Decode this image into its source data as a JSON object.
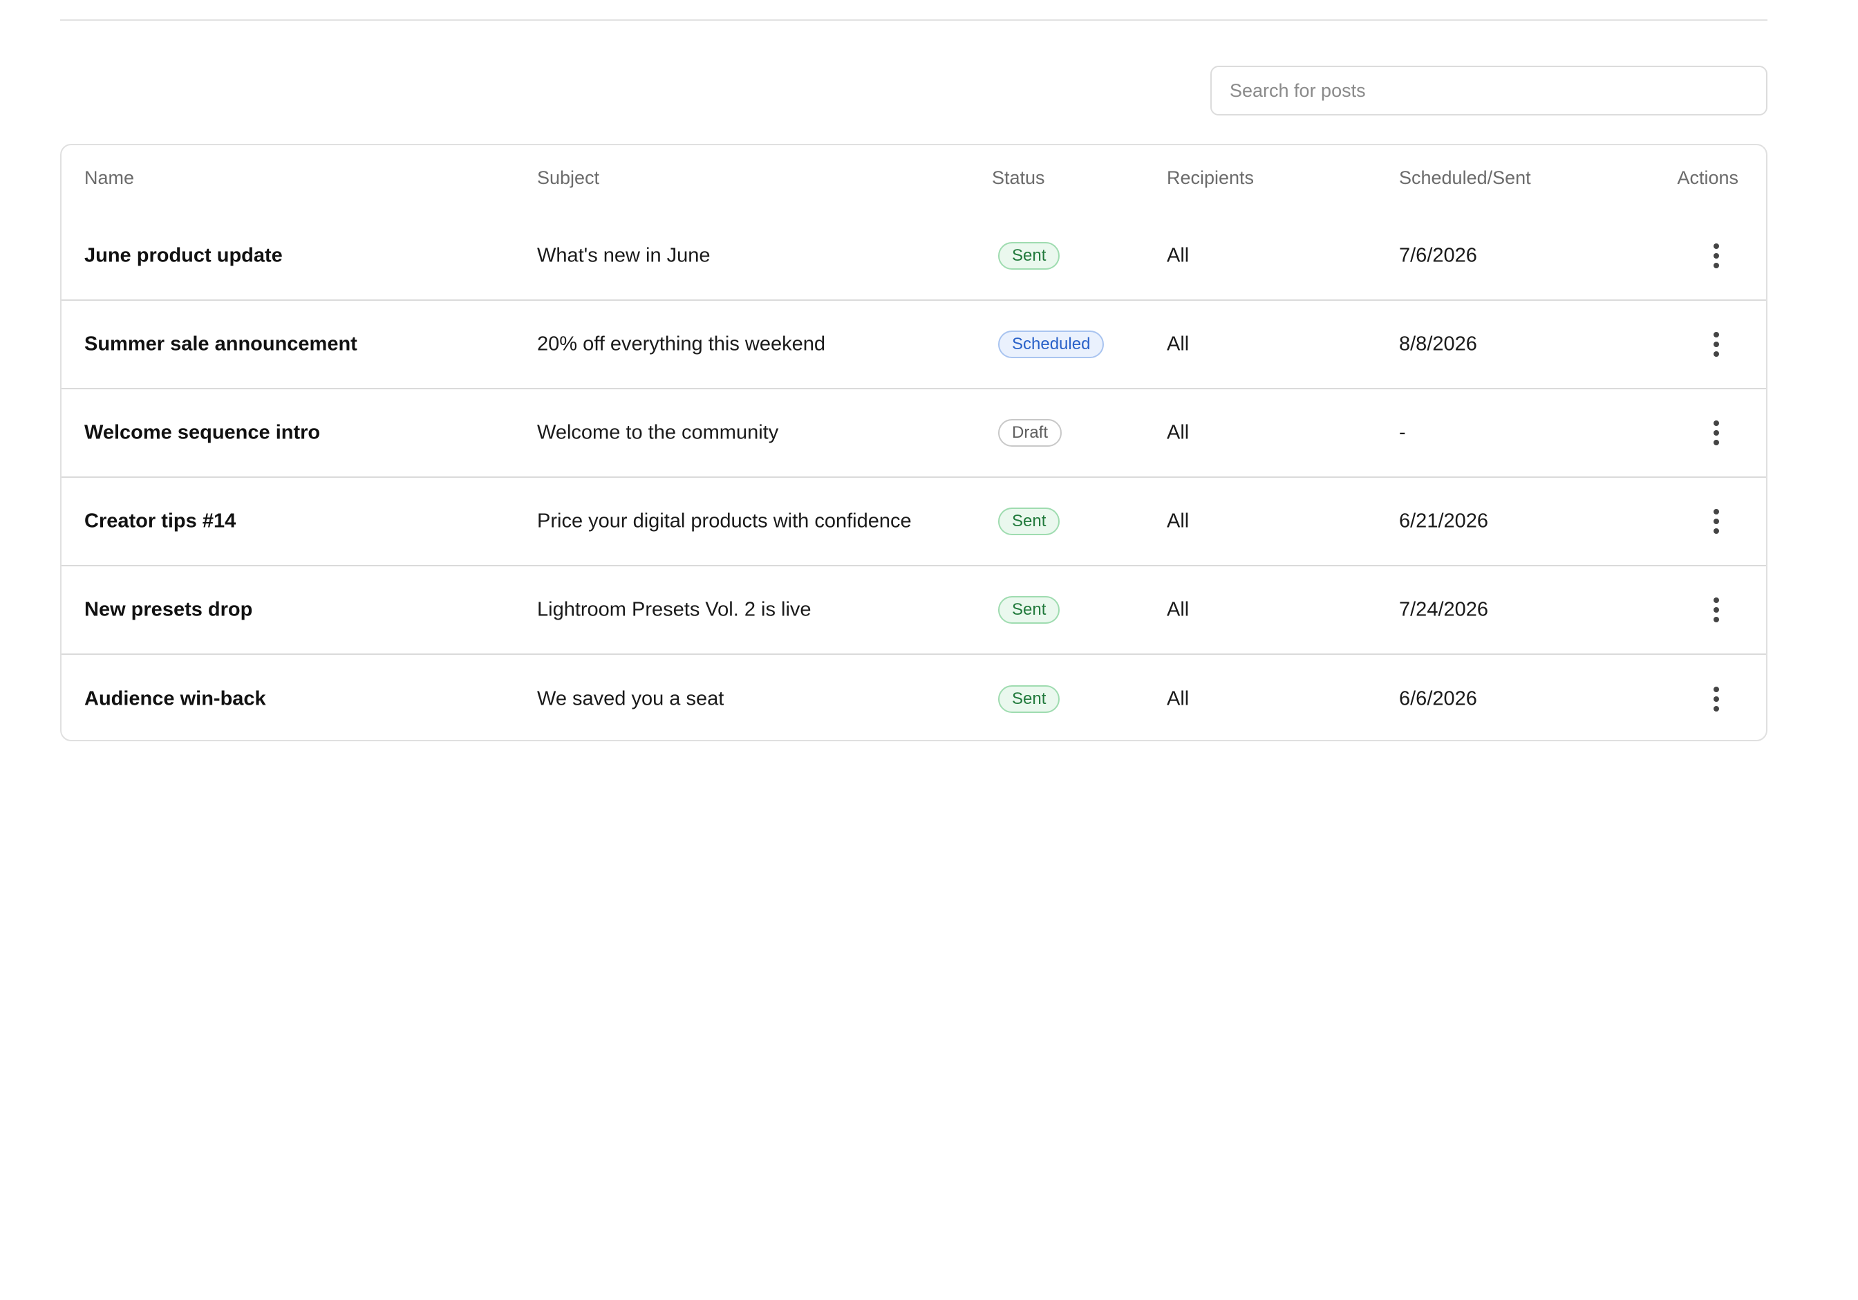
{
  "search": {
    "placeholder": "Search for posts"
  },
  "table": {
    "headers": {
      "name": "Name",
      "subject": "Subject",
      "status": "Status",
      "recipients": "Recipients",
      "scheduled_sent": "Scheduled/Sent",
      "actions": "Actions"
    },
    "rows": [
      {
        "name": "June product update",
        "subject": "What's new in June",
        "status": "Sent",
        "recipients": "All",
        "date": "7/6/2026"
      },
      {
        "name": "Summer sale announcement",
        "subject": "20% off everything this weekend",
        "status": "Scheduled",
        "recipients": "All",
        "date": "8/8/2026"
      },
      {
        "name": "Welcome sequence intro",
        "subject": "Welcome to the community",
        "status": "Draft",
        "recipients": "All",
        "date": "-"
      },
      {
        "name": "Creator tips #14",
        "subject": "Price your digital products with confidence",
        "status": "Sent",
        "recipients": "All",
        "date": "6/21/2026"
      },
      {
        "name": "New presets drop",
        "subject": "Lightroom Presets Vol. 2 is live",
        "status": "Sent",
        "recipients": "All",
        "date": "7/24/2026"
      },
      {
        "name": "Audience win-back",
        "subject": "We saved you a seat",
        "status": "Sent",
        "recipients": "All",
        "date": "6/6/2026"
      }
    ],
    "actions_icon": "more-vertical-icon"
  },
  "colors": {
    "sent_bg": "#eaf8ee",
    "sent_text": "#217a3c",
    "scheduled_bg": "#eaf1fd",
    "scheduled_text": "#2a62c9",
    "draft_text": "#5e5e5e",
    "border": "#e0e0e0"
  }
}
